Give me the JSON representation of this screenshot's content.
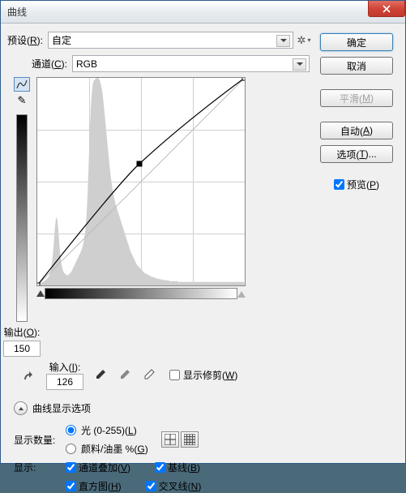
{
  "window": {
    "title": "曲线"
  },
  "preset": {
    "label": "预设(",
    "hot": "R",
    "label2": "):",
    "value": "自定"
  },
  "channel": {
    "label": "通道(",
    "hot": "C",
    "label2": "):",
    "value": "RGB"
  },
  "output": {
    "label": "输出(",
    "hot": "O",
    "label2": "):",
    "value": "150"
  },
  "input": {
    "label": "输入(",
    "hot": "I",
    "label2": "):",
    "value": "126"
  },
  "show_clip": {
    "label": "显示修剪(",
    "hot": "W",
    "label2": ")"
  },
  "section": {
    "label": "曲线显示选项"
  },
  "amount": {
    "label": "显示数量:",
    "opt1": {
      "label": "光 (0-255)(",
      "hot": "L",
      "label2": ")"
    },
    "opt2": {
      "label": "颜料/油墨 %(",
      "hot": "G",
      "label2": ")"
    }
  },
  "show": {
    "label": "显示:",
    "overlay": {
      "label": "通道叠加(",
      "hot": "V",
      "label2": ")"
    },
    "baseline": {
      "label": "基线(",
      "hot": "B",
      "label2": ")"
    },
    "histogram": {
      "label": "直方图(",
      "hot": "H",
      "label2": ")"
    },
    "intersect": {
      "label": "交叉线(",
      "hot": "N",
      "label2": ")"
    }
  },
  "buttons": {
    "ok": "确定",
    "cancel": "取消",
    "smooth": {
      "label": "平滑(",
      "hot": "M",
      "label2": ")"
    },
    "auto": {
      "label": "自动(",
      "hot": "A",
      "label2": ")"
    },
    "options": {
      "label": "选项(",
      "hot": "T",
      "label2": ")..."
    },
    "preview": {
      "label": "预览(",
      "hot": "P",
      "label2": ")"
    }
  },
  "chart_data": {
    "type": "curve",
    "title": "曲线",
    "xlabel": "输入",
    "ylabel": "输出",
    "xlim": [
      0,
      255
    ],
    "ylim": [
      0,
      255
    ],
    "grid": "4x4",
    "baseline": [
      [
        0,
        0
      ],
      [
        255,
        255
      ]
    ],
    "curve_points": [
      [
        0,
        0
      ],
      [
        126,
        150
      ],
      [
        255,
        255
      ]
    ],
    "histogram_bins_0_255": [
      2,
      2,
      2,
      3,
      3,
      3,
      4,
      4,
      5,
      5,
      6,
      7,
      8,
      9,
      10,
      12,
      15,
      20,
      26,
      34,
      45,
      58,
      70,
      78,
      80,
      75,
      65,
      52,
      40,
      30,
      24,
      20,
      17,
      15,
      14,
      13,
      12,
      12,
      12,
      13,
      14,
      15,
      16,
      18,
      20,
      22,
      24,
      26,
      28,
      30,
      32,
      34,
      36,
      38,
      40,
      43,
      46,
      50,
      55,
      62,
      72,
      86,
      105,
      130,
      158,
      186,
      208,
      222,
      232,
      238,
      240,
      241,
      242,
      243,
      243,
      243,
      242,
      240,
      237,
      233,
      228,
      221,
      212,
      202,
      192,
      182,
      172,
      162,
      152,
      142,
      133,
      125,
      118,
      112,
      107,
      102,
      98,
      94,
      91,
      88,
      85,
      82,
      79,
      76,
      73,
      70,
      67,
      64,
      61,
      58,
      55,
      52,
      49,
      46,
      43,
      40,
      38,
      36,
      34,
      32,
      30,
      28,
      26,
      24,
      23,
      22,
      21,
      20,
      19,
      18,
      17,
      16,
      15,
      14,
      14,
      13,
      13,
      12,
      12,
      11,
      11,
      10,
      10,
      10,
      9,
      9,
      9,
      8,
      8,
      8,
      8,
      7,
      7,
      7,
      7,
      7,
      6,
      6,
      6,
      6,
      6,
      6,
      6,
      5,
      5,
      5,
      5,
      5,
      5,
      5,
      5,
      5,
      5,
      5,
      4,
      4,
      4,
      4,
      4,
      4,
      4,
      4,
      4,
      4,
      4,
      4,
      4,
      4,
      4,
      4,
      4,
      4,
      4,
      4,
      4,
      4,
      4,
      4,
      4,
      4,
      4,
      4,
      4,
      4,
      4,
      4,
      4,
      4,
      4,
      4,
      4,
      4,
      4,
      4,
      4,
      4,
      4,
      4,
      4,
      4,
      4,
      4,
      4,
      4,
      4,
      4,
      4,
      4,
      4,
      4,
      4,
      4,
      4,
      4,
      4,
      4,
      4,
      4,
      4,
      4,
      4,
      4,
      4,
      4,
      4,
      4,
      4,
      4,
      4,
      4,
      4,
      4,
      4,
      4,
      4,
      4
    ]
  }
}
